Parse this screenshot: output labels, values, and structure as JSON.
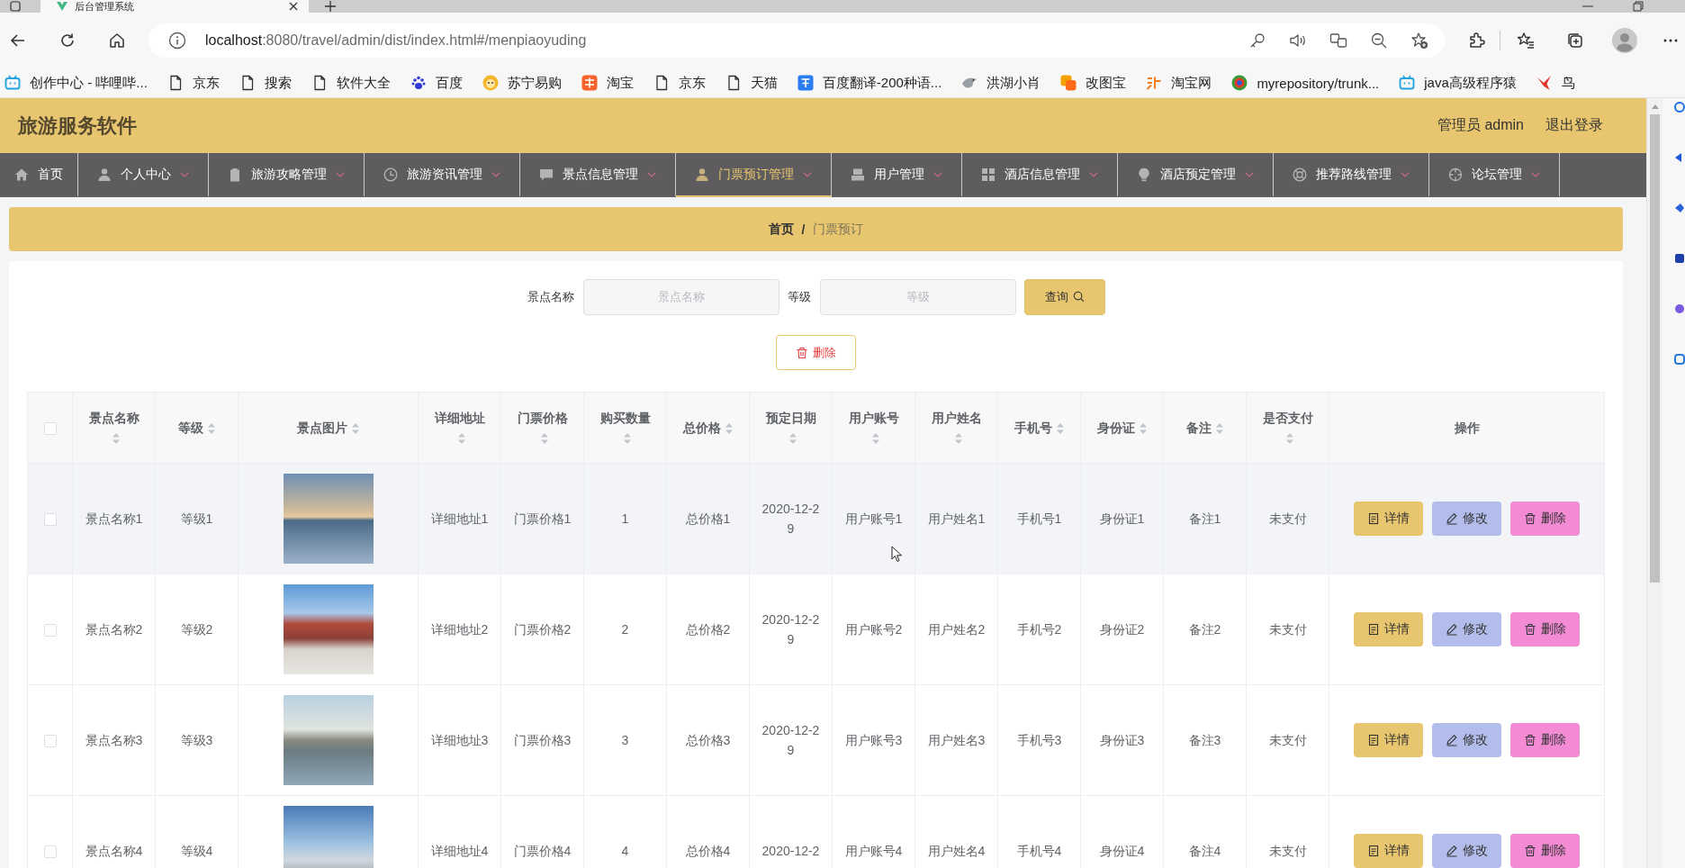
{
  "browser": {
    "tab": {
      "title": "后台管理系统"
    },
    "url_host": "localhost",
    "url_path": ":8080/travel/admin/dist/index.html#/menpiaoyuding",
    "bookmarks": [
      {
        "label": "创作中心 - 哔哩哔...",
        "kind": "tv"
      },
      {
        "label": "京东",
        "kind": "page"
      },
      {
        "label": "搜索",
        "kind": "page"
      },
      {
        "label": "软件大全",
        "kind": "page"
      },
      {
        "label": "百度",
        "kind": "paw"
      },
      {
        "label": "苏宁易购",
        "kind": "lion"
      },
      {
        "label": "淘宝",
        "kind": "tao"
      },
      {
        "label": "京东",
        "kind": "page"
      },
      {
        "label": "天猫",
        "kind": "page"
      },
      {
        "label": "百度翻译-200种语...",
        "kind": "translate"
      },
      {
        "label": "洪湖小肖",
        "kind": "bird"
      },
      {
        "label": "改图宝",
        "kind": "tiles"
      },
      {
        "label": "淘宝网",
        "kind": "shop"
      },
      {
        "label": "myrepository/trunk...",
        "kind": "ring"
      },
      {
        "label": "java高级程序猿",
        "kind": "tv"
      },
      {
        "label": "鸟",
        "kind": "redbird"
      }
    ]
  },
  "header": {
    "title": "旅游服务软件",
    "user": "管理员 admin",
    "logout": "退出登录"
  },
  "nav": [
    {
      "label": "首页",
      "kind": "home",
      "dropdown": false,
      "selected": false
    },
    {
      "label": "个人中心",
      "kind": "user",
      "dropdown": true,
      "selected": false
    },
    {
      "label": "旅游攻略管理",
      "kind": "clipboard",
      "dropdown": true,
      "selected": false
    },
    {
      "label": "旅游资讯管理",
      "kind": "clock",
      "dropdown": true,
      "selected": false
    },
    {
      "label": "景点信息管理",
      "kind": "chat",
      "dropdown": true,
      "selected": false
    },
    {
      "label": "门票预订管理",
      "kind": "user",
      "dropdown": true,
      "selected": true
    },
    {
      "label": "用户管理",
      "kind": "tray",
      "dropdown": true,
      "selected": false
    },
    {
      "label": "酒店信息管理",
      "kind": "grid",
      "dropdown": true,
      "selected": false
    },
    {
      "label": "酒店预定管理",
      "kind": "bulb",
      "dropdown": true,
      "selected": false
    },
    {
      "label": "推荐路线管理",
      "kind": "ring",
      "dropdown": true,
      "selected": false
    },
    {
      "label": "论坛管理",
      "kind": "target",
      "dropdown": true,
      "selected": false
    }
  ],
  "breadcrumb": {
    "items": [
      {
        "label": "首页",
        "current": false
      },
      {
        "label": "门票预订",
        "current": true
      }
    ],
    "separator": "/"
  },
  "search": {
    "fields": [
      {
        "label": "景点名称",
        "placeholder": "景点名称"
      },
      {
        "label": "等级",
        "placeholder": "等级"
      }
    ],
    "button": "查询"
  },
  "delete_button": "删除",
  "table": {
    "select_all": {
      "checked": false
    },
    "columns": [
      {
        "kind": "text",
        "label": "景点名称",
        "sortable": true
      },
      {
        "kind": "text",
        "label": "等级",
        "sortable": true
      },
      {
        "kind": "photo",
        "label": "景点图片",
        "sortable": true
      },
      {
        "kind": "text",
        "label": "详细地址",
        "sortable": true
      },
      {
        "kind": "text",
        "label": "门票价格",
        "sortable": true
      },
      {
        "kind": "text",
        "label": "购买数量",
        "sortable": true
      },
      {
        "kind": "text",
        "label": "总价格",
        "sortable": true
      },
      {
        "kind": "text",
        "label": "预定日期",
        "sortable": true
      },
      {
        "kind": "text",
        "label": "用户账号",
        "sortable": true
      },
      {
        "kind": "text",
        "label": "用户姓名",
        "sortable": true
      },
      {
        "kind": "text",
        "label": "手机号",
        "sortable": true
      },
      {
        "kind": "text",
        "label": "身份证",
        "sortable": true
      },
      {
        "kind": "text",
        "label": "备注",
        "sortable": true
      },
      {
        "kind": "text",
        "label": "是否支付",
        "sortable": true
      },
      {
        "kind": "actions",
        "label": "操作",
        "sortable": false
      }
    ],
    "rows": [
      {
        "checked": false,
        "hovered": true,
        "cells": [
          "景点名称1",
          "等级1",
          "",
          "详细地址1",
          "门票价格1",
          "1",
          "总价格1",
          "2020-12-29",
          "用户账号1",
          "用户姓名1",
          "手机号1",
          "身份证1",
          "备注1",
          "未支付"
        ],
        "actions": [
          {
            "kind": "detail",
            "label": "详情"
          },
          {
            "kind": "edit",
            "label": "修改"
          },
          {
            "kind": "delete",
            "label": "删除"
          }
        ]
      },
      {
        "checked": false,
        "hovered": false,
        "cells": [
          "景点名称2",
          "等级2",
          "",
          "详细地址2",
          "门票价格2",
          "2",
          "总价格2",
          "2020-12-29",
          "用户账号2",
          "用户姓名2",
          "手机号2",
          "身份证2",
          "备注2",
          "未支付"
        ],
        "actions": [
          {
            "kind": "detail",
            "label": "详情"
          },
          {
            "kind": "edit",
            "label": "修改"
          },
          {
            "kind": "delete",
            "label": "删除"
          }
        ]
      },
      {
        "checked": false,
        "hovered": false,
        "cells": [
          "景点名称3",
          "等级3",
          "",
          "详细地址3",
          "门票价格3",
          "3",
          "总价格3",
          "2020-12-29",
          "用户账号3",
          "用户姓名3",
          "手机号3",
          "身份证3",
          "备注3",
          "未支付"
        ],
        "actions": [
          {
            "kind": "detail",
            "label": "详情"
          },
          {
            "kind": "edit",
            "label": "修改"
          },
          {
            "kind": "delete",
            "label": "删除"
          }
        ]
      },
      {
        "checked": false,
        "hovered": false,
        "cells": [
          "景点名称4",
          "等级4",
          "",
          "详细地址4",
          "门票价格4",
          "4",
          "总价格4",
          "2020-12-2",
          "用户账号4",
          "用户姓名4",
          "手机号4",
          "身份证4",
          "备注4",
          "未支付"
        ],
        "actions": [
          {
            "kind": "detail",
            "label": "详情"
          },
          {
            "kind": "edit",
            "label": "修改"
          },
          {
            "kind": "delete",
            "label": "删除"
          }
        ]
      }
    ]
  }
}
